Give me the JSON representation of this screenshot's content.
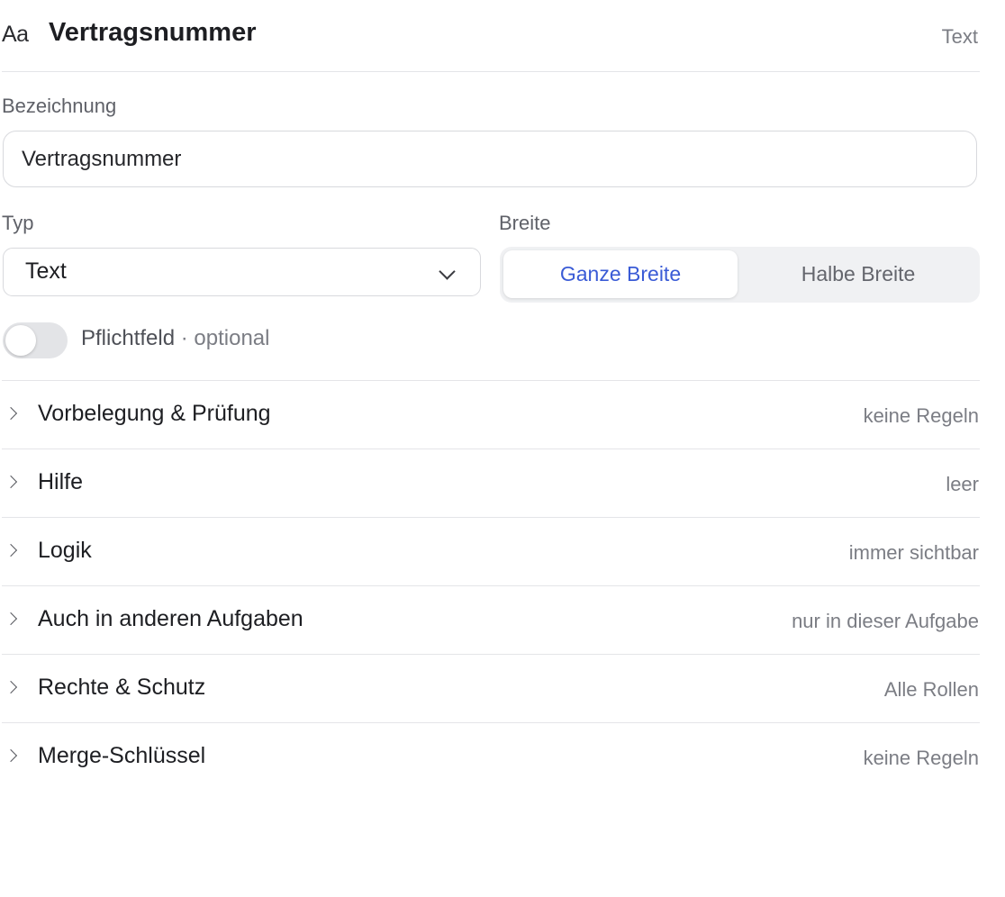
{
  "header": {
    "type_glyph": "Aa",
    "title": "Vertragsnummer",
    "type_label": "Text"
  },
  "name": {
    "label": "Bezeichnung",
    "value": "Vertragsnummer"
  },
  "type_field": {
    "label": "Typ",
    "value": "Text"
  },
  "width_field": {
    "label": "Breite",
    "options": [
      "Ganze Breite",
      "Halbe Breite"
    ],
    "selected": "Ganze Breite"
  },
  "required": {
    "label": "Pflichtfeld",
    "separator": "·",
    "state_text": "optional",
    "on": false
  },
  "sections": [
    {
      "title": "Vorbelegung & Prüfung",
      "summary": "keine Regeln"
    },
    {
      "title": "Hilfe",
      "summary": "leer"
    },
    {
      "title": "Logik",
      "summary": "immer sichtbar"
    },
    {
      "title": "Auch in anderen Aufgaben",
      "summary": "nur in dieser Aufgabe"
    },
    {
      "title": "Rechte & Schutz",
      "summary": "Alle Rollen"
    },
    {
      "title": "Merge-Schlüssel",
      "summary": "keine Regeln"
    }
  ],
  "colors": {
    "accent": "#3a5bd6",
    "border": "#d8d9dd",
    "muted_text": "#7b7d84"
  }
}
